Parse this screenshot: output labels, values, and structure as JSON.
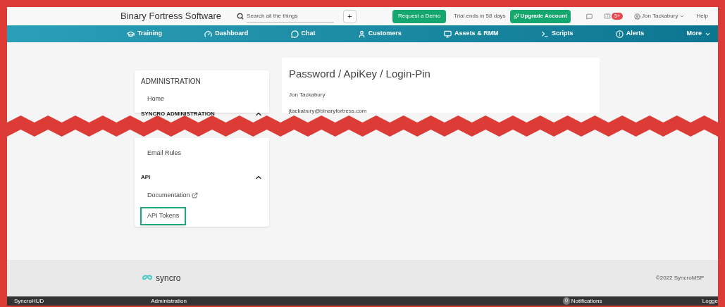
{
  "header": {
    "company": "Binary Fortress Software",
    "search": {
      "placeholder": "Search all the things"
    },
    "add_button": "+",
    "demo_button": "Request a Demo",
    "trial": "Trial ends in 58 days",
    "upgrade_button": "Upgrade Account",
    "ticket_badge": "5+",
    "user": "Jon Tackabury",
    "help": "Help"
  },
  "nav": [
    {
      "label": "Training"
    },
    {
      "label": "Dashboard"
    },
    {
      "label": "Chat"
    },
    {
      "label": "Customers"
    },
    {
      "label": "Assets & RMM"
    },
    {
      "label": "Scripts"
    },
    {
      "label": "Alerts"
    },
    {
      "label": "More"
    }
  ],
  "sidebar": {
    "title": "ADMINISTRATION",
    "top_items": [
      {
        "label": "Home",
        "selected": false
      }
    ],
    "section": {
      "label": "SYNCRO ADMINISTRATION",
      "expanded": true
    },
    "after_tear_items": [
      {
        "label": "Email Rules",
        "selected": false
      }
    ],
    "api": {
      "label": "API",
      "expanded": true,
      "items": [
        {
          "label": "Documentation",
          "external": true,
          "selected": false
        },
        {
          "label": "API Tokens",
          "external": false,
          "selected": true
        }
      ]
    }
  },
  "content": {
    "title": "Password / ApiKey / Login-Pin",
    "name": "Jon Tackabury",
    "email": "jtackabury@binaryfortress.com"
  },
  "footer": {
    "logo": "syncro",
    "copyright": "©2022 SyncroMSP"
  },
  "status_bar": {
    "left": "SyncroHUD",
    "page": "Administration",
    "notification_count": "0",
    "notifications": "Notifications",
    "right": "Logge"
  }
}
